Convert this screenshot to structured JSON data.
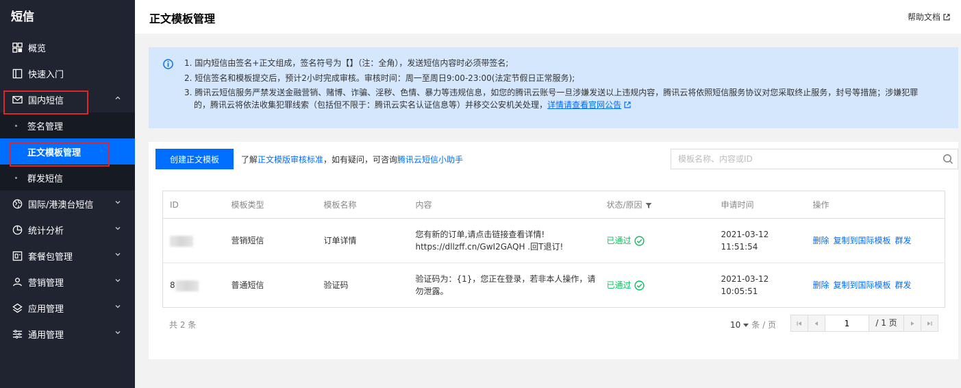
{
  "sidebar": {
    "title": "短信",
    "items": [
      {
        "label": "概览",
        "icon": "grid-icon"
      },
      {
        "label": "快速入门",
        "icon": "book-icon"
      },
      {
        "label": "国内短信",
        "icon": "mail-icon"
      },
      {
        "label": "国际/港澳台短信",
        "icon": "globe-icon"
      },
      {
        "label": "统计分析",
        "icon": "pie-chart-icon"
      },
      {
        "label": "套餐包管理",
        "icon": "package-icon"
      },
      {
        "label": "营销管理",
        "icon": "user-group-icon"
      },
      {
        "label": "应用管理",
        "icon": "layers-icon"
      },
      {
        "label": "通用管理",
        "icon": "sliders-icon"
      }
    ],
    "sub_items": [
      {
        "label": "签名管理"
      },
      {
        "label": "正文模板管理"
      },
      {
        "label": "群发短信"
      }
    ]
  },
  "header": {
    "title": "正文模板管理",
    "help": "帮助文档"
  },
  "info": {
    "line1": "1. 国内短信由签名+正文组成，签名符号为【】（注：全角），发送短信内容时必须带签名;",
    "line2": "2. 短信签名和模板提交后，预计2小时完成审核。审核时间：周一至周日9:00-23:00(法定节假日正常服务);",
    "line3a": "3. 腾讯云短信服务严禁发送金融营销、赌博、诈骗、淫秽、色情、暴力等违规信息，如您的腾讯云账号一旦涉嫌发送以上违规内容，腾讯云将依照短信服务协议对您采取终止服务，封号等措施；涉嫌犯罪",
    "line3b": "的，腾讯云将依法收集犯罪线索（包括但不限于：腾讯云实名认证信息等）并移交公安机关处理，",
    "link": "详情请查看官网公告"
  },
  "toolbar": {
    "create": "创建正文模板",
    "hint_pre": "了解",
    "hint_link1": "正文模版审核标准",
    "hint_mid": "，如有疑问，可咨询",
    "hint_link2": "腾讯云短信小助手",
    "search_placeholder": "模板名称、内容或ID"
  },
  "table": {
    "headers": [
      "ID",
      "模板类型",
      "模板名称",
      "内容",
      "状态/原因",
      "申请时间",
      "操作"
    ],
    "rows": [
      {
        "id": "",
        "type": "营销短信",
        "name": "订单详情",
        "content1": "您有新的订单,请点击链接查看详情!",
        "content2": "https://dllzff.cn/GwI2GAQH .回T退订!",
        "status": "已通过",
        "time": "2021-03-12 11:51:54"
      },
      {
        "id": "8",
        "type": "普通短信",
        "name": "验证码",
        "content1": "验证码为：{1}，您正在登录，若非本人操作，请",
        "content2": "勿泄露。",
        "status": "已通过",
        "time": "2021-03-12 10:05:51"
      }
    ],
    "ops": [
      "删除",
      "复制到国际模板",
      "群发"
    ]
  },
  "footer": {
    "total": "共 2 条",
    "page_size": "10",
    "page_size_unit": "条 / 页",
    "current_page": "1",
    "total_pages": "/ 1 页"
  },
  "colors": {
    "sidebar_bg": "#1f2430",
    "accent": "#006eff",
    "success": "#0abf5b",
    "info_bg": "#d5e7fd",
    "highlight_box": "#e0262b"
  }
}
